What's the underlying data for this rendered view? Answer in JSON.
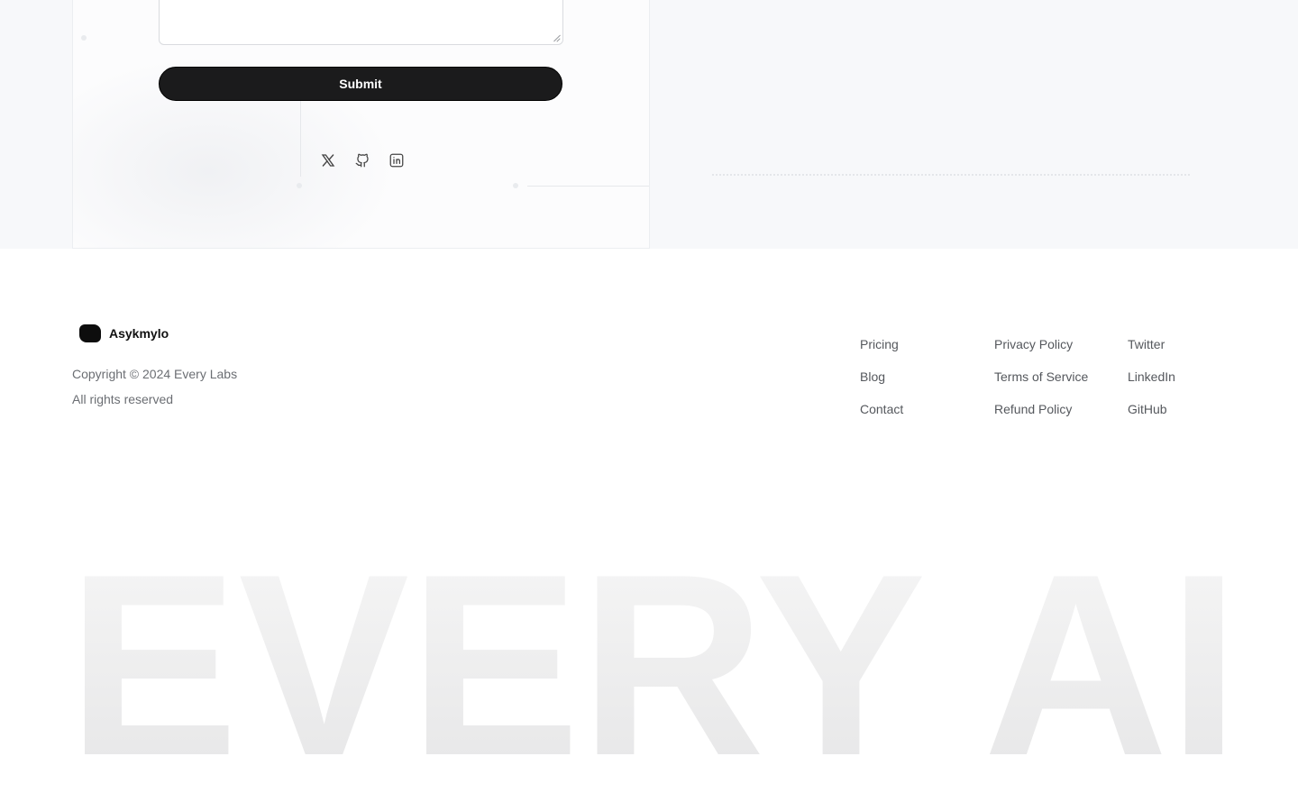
{
  "contact_form": {
    "submit_label": "Submit"
  },
  "social_icons": [
    "x-icon",
    "github-icon",
    "linkedin-icon"
  ],
  "footer": {
    "brand_name": "Asykmylo",
    "copyright": "Copyright © 2024 Every Labs",
    "rights": "All rights reserved",
    "columns": [
      [
        "Pricing",
        "Blog",
        "Contact"
      ],
      [
        "Privacy Policy",
        "Terms of Service",
        "Refund Policy"
      ],
      [
        "Twitter",
        "LinkedIn",
        "GitHub"
      ]
    ],
    "big_wordmark": "EVERY AI"
  },
  "colors": {
    "button_bg": "#1b1b1c",
    "page_bg": "#ffffff",
    "band_bg": "#f7f8fa"
  }
}
